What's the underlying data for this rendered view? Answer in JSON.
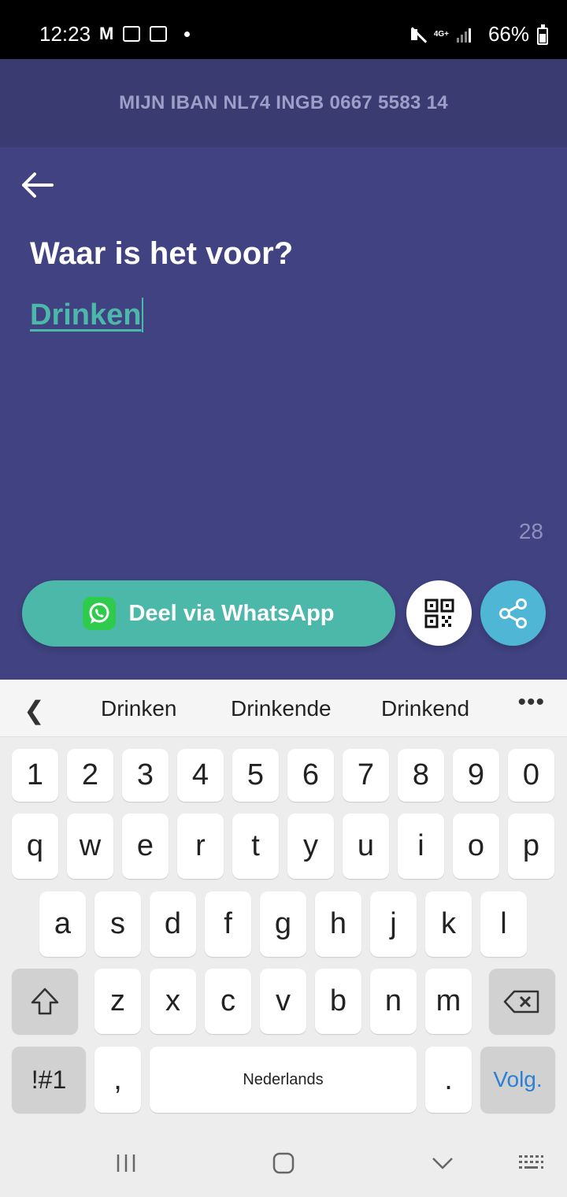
{
  "status_bar": {
    "time": "12:23",
    "network": "4G+",
    "battery": "66%"
  },
  "iban": {
    "label": "MIJN IBAN NL74 INGB 0667 5583 14"
  },
  "main": {
    "question": "Waar is het voor?",
    "answer": "Drinken",
    "char_counter": "28"
  },
  "actions": {
    "whatsapp_label": "Deel via WhatsApp",
    "whatsapp_color": "#4cb8aa",
    "share_color": "#4fb6d6"
  },
  "keyboard": {
    "suggestions": [
      "Drinken",
      "Drinkende",
      "Drinkend"
    ],
    "number_row": [
      "1",
      "2",
      "3",
      "4",
      "5",
      "6",
      "7",
      "8",
      "9",
      "0"
    ],
    "row1": [
      "q",
      "w",
      "e",
      "r",
      "t",
      "y",
      "u",
      "i",
      "o",
      "p"
    ],
    "row2": [
      "a",
      "s",
      "d",
      "f",
      "g",
      "h",
      "j",
      "k",
      "l"
    ],
    "row3": [
      "z",
      "x",
      "c",
      "v",
      "b",
      "n",
      "m"
    ],
    "symbols_key": "!#1",
    "comma_key": ",",
    "space_key": "Nederlands",
    "period_key": ".",
    "next_key": "Volg."
  }
}
